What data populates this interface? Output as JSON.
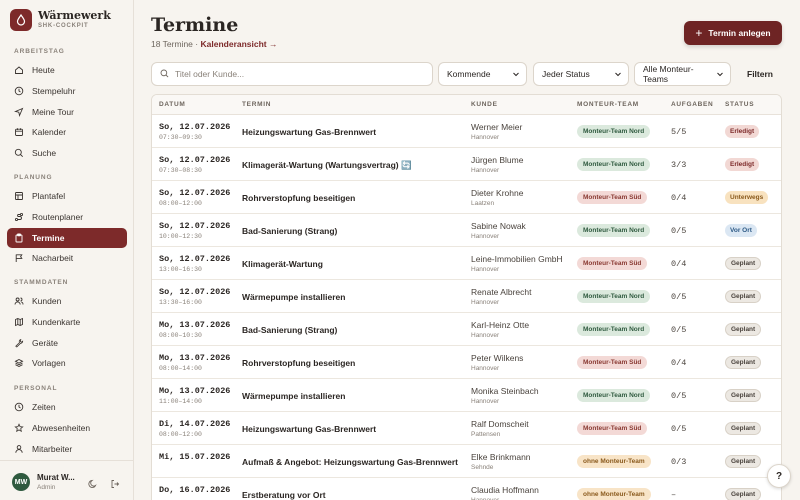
{
  "brand": {
    "name": "Wärmewerk",
    "sub": "SHK-COCKPIT"
  },
  "nav": {
    "sections": [
      {
        "label": "ARBEITSTAG",
        "items": [
          {
            "label": "Heute",
            "icon": "home-icon"
          },
          {
            "label": "Stempeluhr",
            "icon": "clock-icon"
          },
          {
            "label": "Meine Tour",
            "icon": "navigation-icon"
          },
          {
            "label": "Kalender",
            "icon": "calendar-icon"
          },
          {
            "label": "Suche",
            "icon": "search-icon"
          }
        ]
      },
      {
        "label": "PLANUNG",
        "items": [
          {
            "label": "Plantafel",
            "icon": "board-icon"
          },
          {
            "label": "Routenplaner",
            "icon": "route-icon"
          },
          {
            "label": "Termine",
            "icon": "clipboard-icon",
            "active": true
          },
          {
            "label": "Nacharbeit",
            "icon": "flag-icon"
          }
        ]
      },
      {
        "label": "STAMMDATEN",
        "items": [
          {
            "label": "Kunden",
            "icon": "users-icon"
          },
          {
            "label": "Kundenkarte",
            "icon": "map-icon"
          },
          {
            "label": "Geräte",
            "icon": "wrench-icon"
          },
          {
            "label": "Vorlagen",
            "icon": "layers-icon"
          }
        ]
      },
      {
        "label": "PERSONAL",
        "items": [
          {
            "label": "Zeiten",
            "icon": "clock-icon"
          },
          {
            "label": "Abwesenheiten",
            "icon": "star-icon"
          },
          {
            "label": "Mitarbeiter",
            "icon": "user-icon"
          }
        ]
      }
    ]
  },
  "user": {
    "initials": "MW",
    "name": "Murat W...",
    "role": "Admin"
  },
  "header": {
    "title": "Termine",
    "count": "18 Termine",
    "separator": "·",
    "link": "Kalenderansicht →",
    "new_button": "Termin anlegen"
  },
  "filters": {
    "search_placeholder": "Titel oder Kunde...",
    "time": "Kommende",
    "status": "Jeder Status",
    "team": "Alle Monteur-Teams",
    "filter_button": "Filtern"
  },
  "table": {
    "columns": [
      "DATUM",
      "TERMIN",
      "KUNDE",
      "MONTEUR-TEAM",
      "AUFGABEN",
      "STATUS"
    ],
    "rows": [
      {
        "date": "So, 12.07.2026",
        "time": "07:30–09:30",
        "title": "Heizungswartung Gas-Brennwert",
        "customer": "Werner Meier",
        "city": "Hannover",
        "team": "Monteur-Team Nord",
        "team_kind": "nord",
        "tasks": "5/5",
        "status": "Erledigt",
        "status_kind": "erledigt"
      },
      {
        "date": "So, 12.07.2026",
        "time": "07:30–08:30",
        "title": "Klimagerät-Wartung (Wartungsvertrag) 🔄",
        "customer": "Jürgen Blume",
        "city": "Hannover",
        "team": "Monteur-Team Nord",
        "team_kind": "nord",
        "tasks": "3/3",
        "status": "Erledigt",
        "status_kind": "erledigt"
      },
      {
        "date": "So, 12.07.2026",
        "time": "08:00–12:00",
        "title": "Rohrverstopfung beseitigen",
        "customer": "Dieter Krohne",
        "city": "Laatzen",
        "team": "Monteur-Team Süd",
        "team_kind": "sued",
        "tasks": "0/4",
        "status": "Unterwegs",
        "status_kind": "unterwegs"
      },
      {
        "date": "So, 12.07.2026",
        "time": "10:00–12:30",
        "title": "Bad-Sanierung (Strang)",
        "customer": "Sabine Nowak",
        "city": "Hannover",
        "team": "Monteur-Team Nord",
        "team_kind": "nord",
        "tasks": "0/5",
        "status": "Vor Ort",
        "status_kind": "vorort"
      },
      {
        "date": "So, 12.07.2026",
        "time": "13:00–16:30",
        "title": "Klimagerät-Wartung",
        "customer": "Leine-Immobilien GmbH",
        "city": "Hannover",
        "team": "Monteur-Team Süd",
        "team_kind": "sued",
        "tasks": "0/4",
        "status": "Geplant",
        "status_kind": "geplant"
      },
      {
        "date": "So, 12.07.2026",
        "time": "13:30–16:00",
        "title": "Wärmepumpe installieren",
        "customer": "Renate Albrecht",
        "city": "Hannover",
        "team": "Monteur-Team Nord",
        "team_kind": "nord",
        "tasks": "0/5",
        "status": "Geplant",
        "status_kind": "geplant"
      },
      {
        "date": "Mo, 13.07.2026",
        "time": "08:00–10:30",
        "title": "Bad-Sanierung (Strang)",
        "customer": "Karl-Heinz Otte",
        "city": "Hannover",
        "team": "Monteur-Team Nord",
        "team_kind": "nord",
        "tasks": "0/5",
        "status": "Geplant",
        "status_kind": "geplant"
      },
      {
        "date": "Mo, 13.07.2026",
        "time": "08:00–14:00",
        "title": "Rohrverstopfung beseitigen",
        "customer": "Peter Wilkens",
        "city": "Hannover",
        "team": "Monteur-Team Süd",
        "team_kind": "sued",
        "tasks": "0/4",
        "status": "Geplant",
        "status_kind": "geplant"
      },
      {
        "date": "Mo, 13.07.2026",
        "time": "11:00–14:00",
        "title": "Wärmepumpe installieren",
        "customer": "Monika Steinbach",
        "city": "Hannover",
        "team": "Monteur-Team Nord",
        "team_kind": "nord",
        "tasks": "0/5",
        "status": "Geplant",
        "status_kind": "geplant"
      },
      {
        "date": "Di, 14.07.2026",
        "time": "08:00–12:00",
        "title": "Heizungswartung Gas-Brennwert",
        "customer": "Ralf Domscheit",
        "city": "Pattensen",
        "team": "Monteur-Team Süd",
        "team_kind": "sued",
        "tasks": "0/5",
        "status": "Geplant",
        "status_kind": "geplant"
      },
      {
        "date": "Mi, 15.07.2026",
        "time": "",
        "title": "Aufmaß & Angebot: Heizungswartung Gas-Brennwert",
        "customer": "Elke Brinkmann",
        "city": "Sehnde",
        "team": "ohne Monteur-Team",
        "team_kind": "none",
        "tasks": "0/3",
        "status": "Geplant",
        "status_kind": "geplant"
      },
      {
        "date": "Do, 16.07.2026",
        "time": "",
        "title": "Erstberatung vor Ort",
        "customer": "Claudia Hoffmann",
        "city": "Hannover",
        "team": "ohne Monteur-Team",
        "team_kind": "none",
        "tasks": "–",
        "status": "Geplant",
        "status_kind": "geplant"
      }
    ]
  },
  "help": "?"
}
